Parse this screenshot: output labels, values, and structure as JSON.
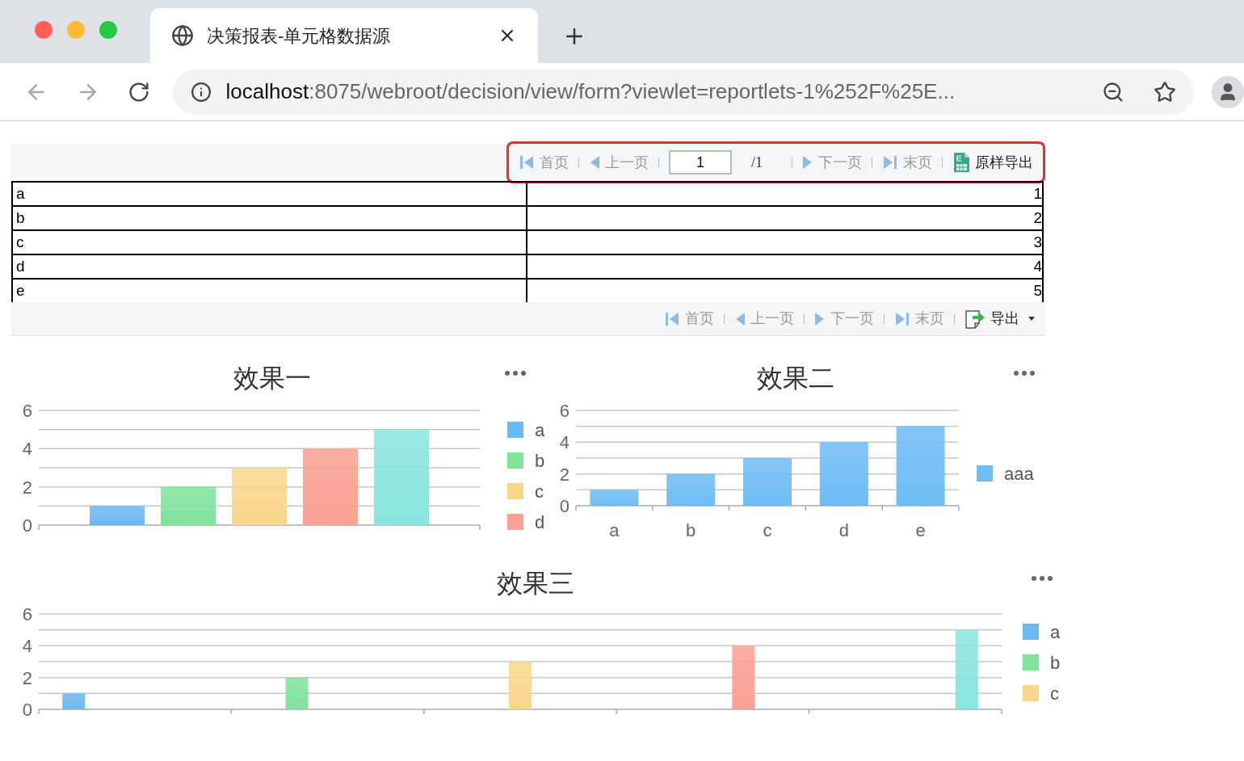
{
  "browser": {
    "tab_title": "决策报表-单元格数据源",
    "url_host": "localhost",
    "url_path": ":8075/webroot/decision/view/form?viewlet=reportlets-1%252F%25E..."
  },
  "pager": {
    "highlighted": true,
    "page_value": "1",
    "page_total": "/1",
    "items": [
      {
        "kind": "first",
        "label": "首页",
        "disabled": true
      },
      {
        "kind": "prev",
        "label": "上一页",
        "disabled": true
      },
      {
        "kind": "page"
      },
      {
        "kind": "next",
        "label": "下一页",
        "disabled": true
      },
      {
        "kind": "last",
        "label": "末页",
        "disabled": true
      },
      {
        "kind": "excel",
        "label": "原样导出",
        "disabled": false
      }
    ]
  },
  "table": {
    "rows": [
      {
        "label": "a",
        "value": "1"
      },
      {
        "label": "b",
        "value": "2"
      },
      {
        "label": "c",
        "value": "3"
      },
      {
        "label": "d",
        "value": "4"
      },
      {
        "label": "e",
        "value": "5"
      }
    ]
  },
  "bottom_toolbar": {
    "items": [
      {
        "kind": "first",
        "label": "首页",
        "disabled": true
      },
      {
        "kind": "prev",
        "label": "上一页",
        "disabled": true
      },
      {
        "kind": "next",
        "label": "下一页",
        "disabled": true
      },
      {
        "kind": "last",
        "label": "末页",
        "disabled": true
      },
      {
        "kind": "export",
        "label": "导出",
        "disabled": false
      }
    ]
  },
  "charts": [
    {
      "chart_data": {
        "type": "bar",
        "title": "效果一",
        "legend": "right",
        "ylim": [
          0,
          6
        ],
        "yticks": [
          0,
          2,
          4,
          6
        ],
        "series": [
          {
            "name": "a",
            "color": "#6cb8f2",
            "values": [
              1
            ]
          },
          {
            "name": "b",
            "color": "#80e39c",
            "values": [
              2
            ]
          },
          {
            "name": "c",
            "color": "#fad68a",
            "values": [
              3
            ]
          },
          {
            "name": "d",
            "color": "#f9a193",
            "values": [
              4
            ]
          },
          {
            "color": "#88e5dd",
            "values": [
              5
            ]
          }
        ]
      }
    },
    {
      "chart_data": {
        "type": "bar",
        "title": "效果二",
        "categories": [
          "a",
          "b",
          "c",
          "d",
          "e"
        ],
        "legend": "right",
        "ylim": [
          0,
          6
        ],
        "yticks": [
          0,
          2,
          4,
          6
        ],
        "series": [
          {
            "name": "aaa",
            "color": "#6ebdf5",
            "values": [
              1,
              2,
              3,
              4,
              5
            ]
          }
        ]
      }
    },
    {
      "chart_data": {
        "type": "bar",
        "title": "效果三",
        "legend": "right",
        "ylim": [
          0,
          6
        ],
        "yticks": [
          0,
          2,
          4,
          6
        ],
        "series": [
          {
            "name": "a",
            "color": "#6cb8f2",
            "values": [
              1,
              null,
              null,
              null,
              null
            ]
          },
          {
            "name": "b",
            "color": "#80e39c",
            "values": [
              null,
              2,
              null,
              null,
              null
            ]
          },
          {
            "name": "c",
            "color": "#fad68a",
            "values": [
              null,
              null,
              3,
              null,
              null
            ]
          },
          {
            "color": "#f9a193",
            "values": [
              null,
              null,
              null,
              4,
              null
            ]
          },
          {
            "color": "#88e5dd",
            "values": [
              null,
              null,
              null,
              null,
              5
            ]
          }
        ]
      }
    }
  ]
}
